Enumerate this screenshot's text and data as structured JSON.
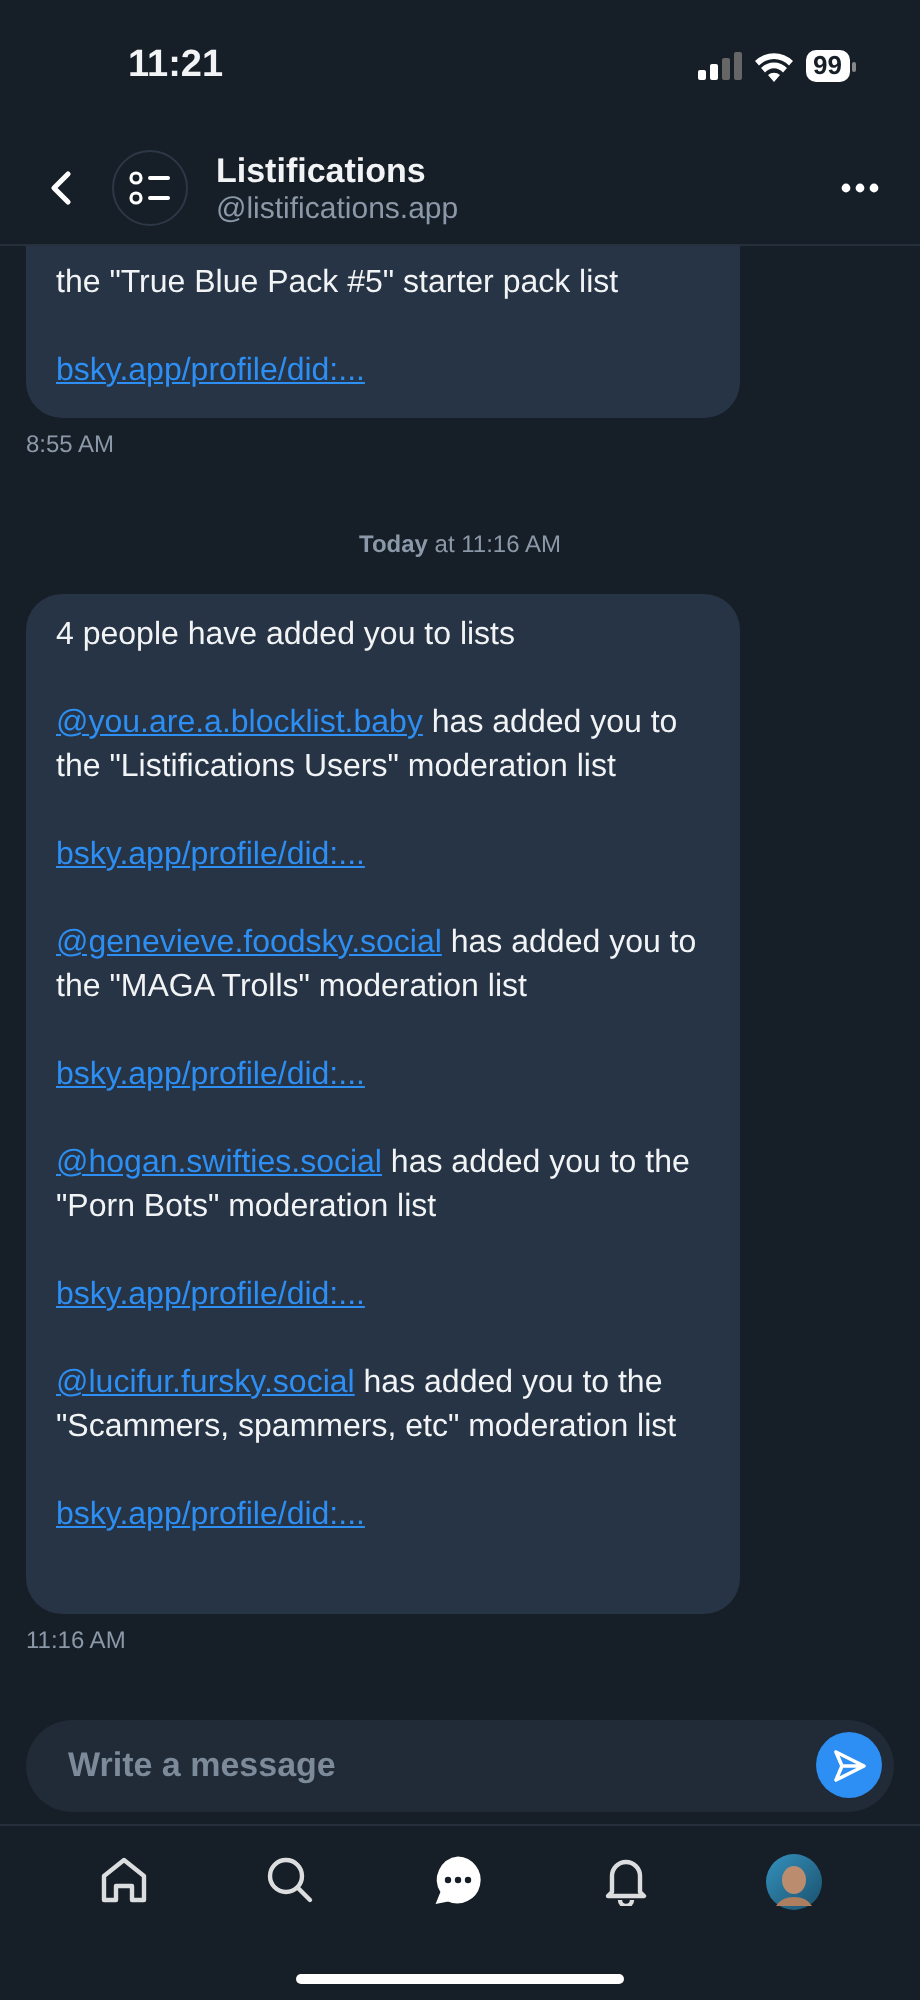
{
  "status_bar": {
    "time": "11:21",
    "battery": "99"
  },
  "header": {
    "title": "Listifications",
    "handle": "@listifications.app"
  },
  "messages": [
    {
      "blocks": [
        {
          "kind": "plain",
          "text": "the \"True Blue Pack #5\" starter pack list"
        },
        {
          "kind": "link",
          "text": "bsky.app/profile/did:..."
        }
      ],
      "time": "8:55 AM"
    },
    {
      "divider": {
        "day": "Today",
        "time": " at 11:16 AM"
      }
    },
    {
      "blocks": [
        {
          "kind": "plain",
          "text": "4 people have added you to lists"
        },
        {
          "kind": "mention",
          "handle": "@you.are.a.blocklist.baby",
          "text": " has added you to the \"Listifications Users\" moderation list"
        },
        {
          "kind": "link",
          "text": "bsky.app/profile/did:..."
        },
        {
          "kind": "mention",
          "handle": "@genevieve.foodsky.social",
          "text": " has added you to the \"MAGA Trolls\" moderation list"
        },
        {
          "kind": "link",
          "text": "bsky.app/profile/did:..."
        },
        {
          "kind": "mention",
          "handle": "@hogan.swifties.social",
          "text": " has added you to the \"Porn Bots\" moderation list"
        },
        {
          "kind": "link",
          "text": "bsky.app/profile/did:..."
        },
        {
          "kind": "mention",
          "handle": "@lucifur.fursky.social",
          "text": " has added you to the \"Scammers, spammers, etc\" moderation list"
        },
        {
          "kind": "link",
          "text": "bsky.app/profile/did:..."
        }
      ],
      "time": "11:16 AM"
    }
  ],
  "composer": {
    "placeholder": "Write a message"
  },
  "tabs": [
    {
      "kind": "home",
      "selected": false
    },
    {
      "kind": "search",
      "selected": false
    },
    {
      "kind": "chat",
      "selected": true
    },
    {
      "kind": "bell",
      "selected": false
    },
    {
      "kind": "avatar",
      "selected": false
    }
  ]
}
